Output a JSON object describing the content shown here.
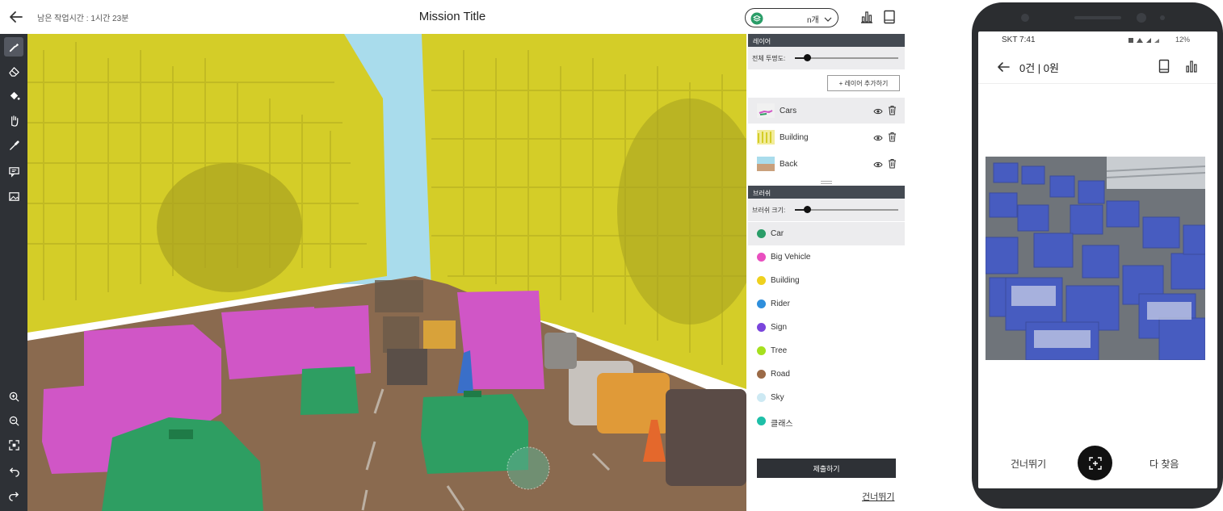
{
  "desktop": {
    "remaining_time": "남은 작업시간 : 1시간 23분",
    "mission_title": "Mission Title",
    "layer_count_select": "n개",
    "layers_panel": {
      "header": "레이어",
      "opacity_label": "전체 투명도:",
      "opacity_value": 0.12,
      "add_layer_button": "+ 레이어 추가하기",
      "layers": [
        {
          "name": "Cars",
          "selected": true
        },
        {
          "name": "Building",
          "selected": false
        },
        {
          "name": "Back",
          "selected": false
        }
      ]
    },
    "brush_panel": {
      "header": "브러쉬",
      "size_label": "브러쉬 크기:",
      "size_value": 0.12,
      "classes": [
        {
          "name": "Car",
          "color": "#2a9d68",
          "selected": true
        },
        {
          "name": "Big Vehicle",
          "color": "#e94fbf",
          "selected": false
        },
        {
          "name": "Building",
          "color": "#efd11e",
          "selected": false
        },
        {
          "name": "Rider",
          "color": "#2f8fdc",
          "selected": false
        },
        {
          "name": "Sign",
          "color": "#7a45dc",
          "selected": false
        },
        {
          "name": "Tree",
          "color": "#a6e01e",
          "selected": false
        },
        {
          "name": "Road",
          "color": "#9b6a47",
          "selected": false
        },
        {
          "name": "Sky",
          "color": "#cde9f3",
          "selected": false
        },
        {
          "name": "클래스",
          "color": "#1ebfa8",
          "selected": false
        }
      ]
    },
    "submit_button": "제출하기",
    "skip_link": "건너뛰기"
  },
  "phone": {
    "status_time": "SKT 7:41",
    "status_right": "12%",
    "count_title": "0건 | 0원",
    "skip_button": "건너뛰기",
    "done_button": "다 찾음"
  },
  "colors": {
    "building_overlay": "#d4cd28",
    "road_overlay": "#8a6a4f",
    "sky": "#a9dcec",
    "car_overlay": "#2e9e62",
    "big_vehicle_overlay": "#d056c6",
    "toolbar_bg": "#2e3136",
    "detection_box": "#3a55d8"
  }
}
